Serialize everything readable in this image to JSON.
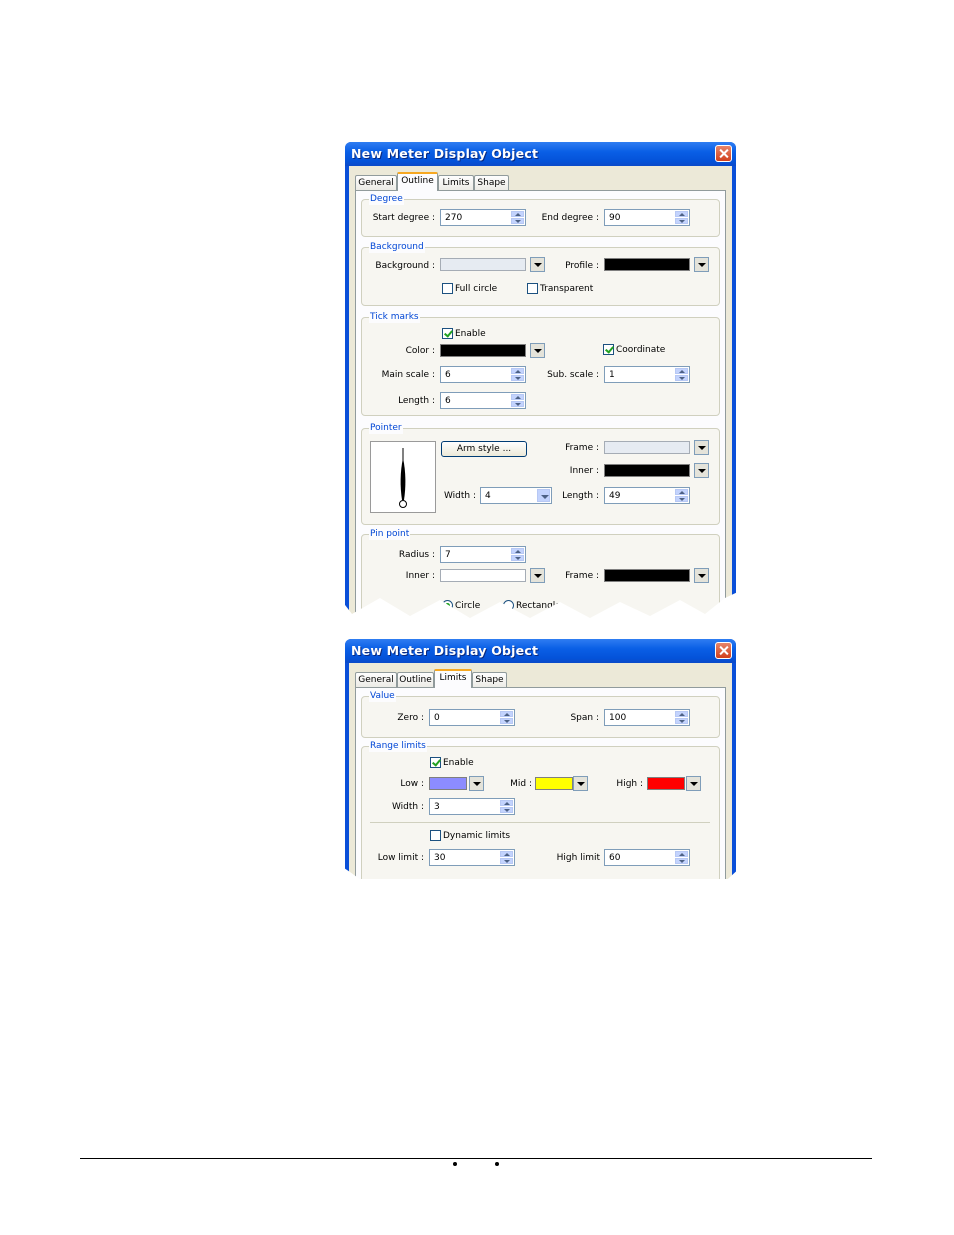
{
  "dialog1": {
    "title": "New  Meter Display Object",
    "tabs": [
      "General",
      "Outline",
      "Limits",
      "Shape"
    ],
    "active_tab": "Outline",
    "degree": {
      "group_title": "Degree",
      "start_label": "Start degree :",
      "start_value": "270",
      "end_label": "End degree :",
      "end_value": "90"
    },
    "background": {
      "group_title": "Background",
      "background_label": "Background :",
      "profile_label": "Profile :",
      "full_circle_label": "Full circle",
      "transparent_label": "Transparent",
      "background_color": "#e6ebf2",
      "profile_color": "#000000",
      "full_circle_checked": false,
      "transparent_checked": false
    },
    "tick_marks": {
      "group_title": "Tick marks",
      "enable_label": "Enable",
      "enable_checked": true,
      "color_label": "Color :",
      "color_value": "#000000",
      "coordinate_label": "Coordinate",
      "coordinate_checked": true,
      "main_scale_label": "Main scale :",
      "main_scale_value": "6",
      "sub_scale_label": "Sub. scale :",
      "sub_scale_value": "1",
      "length_label": "Length :",
      "length_value": "6"
    },
    "pointer": {
      "group_title": "Pointer",
      "arm_style_label": "Arm style ...",
      "frame_label": "Frame :",
      "frame_color": "#e6ebf2",
      "inner_label": "Inner :",
      "inner_color": "#000000",
      "width_label": "Width :",
      "width_value": "4",
      "length_label": "Length :",
      "length_value": "49"
    },
    "pin_point": {
      "group_title": "Pin point",
      "radius_label": "Radius :",
      "radius_value": "7",
      "inner_label": "Inner :",
      "inner_color": "#ffffff",
      "frame_label": "Frame :",
      "frame_color": "#000000",
      "circle_label": "Circle",
      "rectangle_label": "Rectangle",
      "selected_shape": "Circle"
    }
  },
  "dialog2": {
    "title": "New  Meter Display Object",
    "tabs": [
      "General",
      "Outline",
      "Limits",
      "Shape"
    ],
    "active_tab": "Limits",
    "value": {
      "group_title": "Value",
      "zero_label": "Zero :",
      "zero_value": "0",
      "span_label": "Span :",
      "span_value": "100"
    },
    "range_limits": {
      "group_title": "Range limits",
      "enable_label": "Enable",
      "enable_checked": true,
      "low_label": "Low  :",
      "low_color": "#8c8cff",
      "mid_label": "Mid  :",
      "mid_color": "#ffff00",
      "high_label": "High :",
      "high_color": "#ff0000",
      "width_label": "Width :",
      "width_value": "3",
      "dynamic_limits_label": "Dynamic limits",
      "dynamic_limits_checked": false,
      "low_limit_label": "Low limit :",
      "low_limit_value": "30",
      "high_limit_label": "High limit",
      "high_limit_value": "60"
    }
  }
}
